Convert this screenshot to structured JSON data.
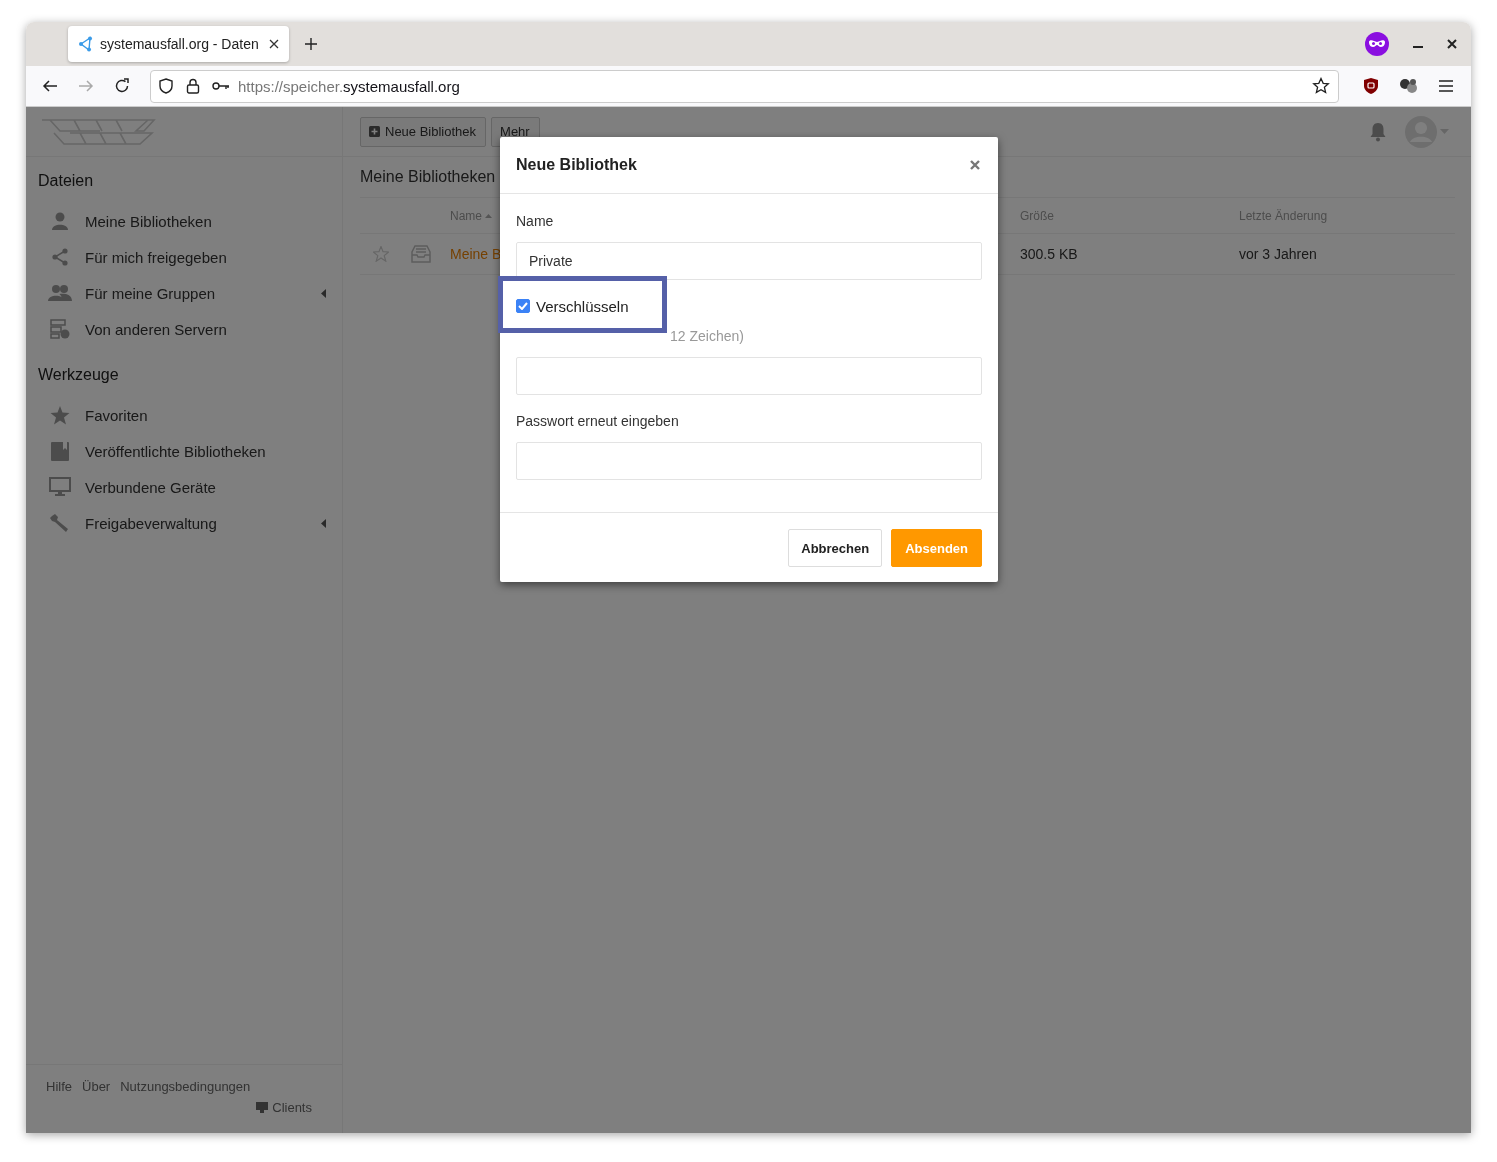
{
  "browser": {
    "tab": {
      "title": "systemausfall.org - Daten"
    },
    "url": {
      "dim": "https://speicher.",
      "main": "systemausfall.org"
    }
  },
  "toolbar": {
    "buttons": [
      {
        "label": "Neue Bibliothek",
        "kind": "add"
      },
      {
        "label": "Mehr",
        "kind": "plain"
      }
    ]
  },
  "sidebar": {
    "sections": [
      {
        "title": "Dateien",
        "items": [
          {
            "label": "Meine Bibliotheken",
            "submenu": false
          },
          {
            "label": "Für mich freigegeben",
            "submenu": false
          },
          {
            "label": "Für meine Gruppen",
            "submenu": true
          },
          {
            "label": "Von anderen Servern",
            "submenu": false
          }
        ]
      },
      {
        "title": "Werkzeuge",
        "items": [
          {
            "label": "Favoriten",
            "submenu": false
          },
          {
            "label": "Veröffentlichte Bibliotheken",
            "submenu": false
          },
          {
            "label": "Verbundene Geräte",
            "submenu": false
          },
          {
            "label": "Freigabeverwaltung",
            "submenu": true
          }
        ]
      }
    ],
    "footer_links": [
      "Hilfe",
      "Über",
      "Nutzungsbedingungen"
    ],
    "clients": "Clients"
  },
  "main": {
    "heading": "Meine Bibliotheken",
    "columns": [
      {
        "label": "Name",
        "sorted": true
      },
      {
        "label": "Größe",
        "sorted": false
      },
      {
        "label": "Letzte Änderung",
        "sorted": false
      }
    ],
    "rows": [
      {
        "name": "Meine B",
        "size": "300.5 KB",
        "modified": "vor 3 Jahren",
        "starred": false
      }
    ]
  },
  "modal": {
    "title": "Neue Bibliothek",
    "name_label": "Name",
    "name_value": "Private",
    "encrypt": {
      "label": "Verschlüsseln",
      "checked": true
    },
    "password_hint": "12 Zeichen)",
    "repeat_label": "Passwort erneut eingeben",
    "buttons": [
      {
        "label": "Abbrechen",
        "kind": "secondary"
      },
      {
        "label": "Absenden",
        "kind": "primary"
      }
    ]
  }
}
